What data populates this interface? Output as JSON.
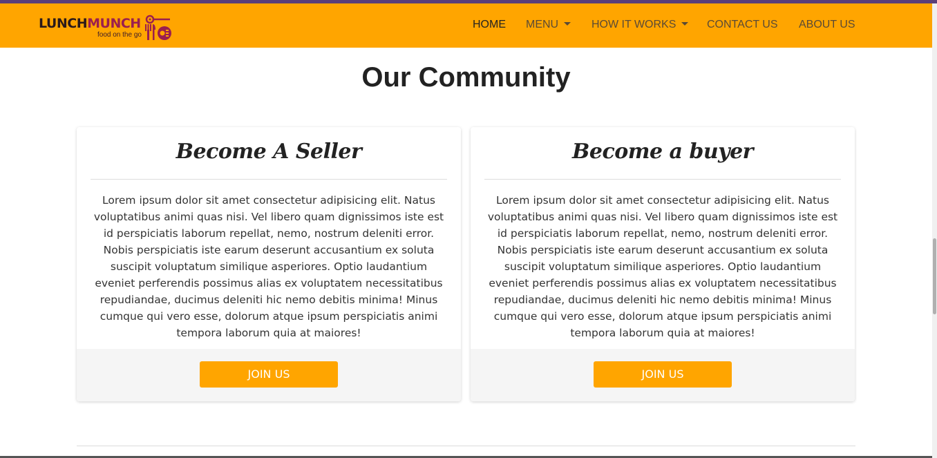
{
  "brand": {
    "name_part1": "LUNCH",
    "name_part2": "MUNCH",
    "tagline": "food on the go",
    "colors": {
      "navbar": "#ffa500",
      "accent": "#9b1f4e",
      "button": "#ffa500"
    }
  },
  "nav": {
    "items": [
      {
        "label": "HOME",
        "active": true,
        "dropdown": false
      },
      {
        "label": "MENU",
        "active": false,
        "dropdown": true
      },
      {
        "label": "HOW IT WORKS",
        "active": false,
        "dropdown": true
      },
      {
        "label": "CONTACT US",
        "active": false,
        "dropdown": false
      },
      {
        "label": "ABOUT US",
        "active": false,
        "dropdown": false
      }
    ]
  },
  "section": {
    "title": "Our Community"
  },
  "cards": [
    {
      "heading": "Become A Seller",
      "body": "Lorem ipsum dolor sit amet consectetur adipisicing elit. Natus voluptatibus animi quas nisi. Vel libero quam dignissimos iste est id perspiciatis laborum repellat, nemo, nostrum deleniti error. Nobis perspiciatis iste earum deserunt accusantium ex soluta suscipit voluptatum similique asperiores. Optio laudantium eveniet perferendis possimus alias ex voluptatem necessitatibus repudiandae, ducimus deleniti hic nemo debitis minima! Minus cumque qui vero esse, dolorum atque ipsum perspiciatis animi tempora laborum quia at maiores!",
      "button": "JOIN US"
    },
    {
      "heading": "Become a buyer",
      "body": "Lorem ipsum dolor sit amet consectetur adipisicing elit. Natus voluptatibus animi quas nisi. Vel libero quam dignissimos iste est id perspiciatis laborum repellat, nemo, nostrum deleniti error. Nobis perspiciatis iste earum deserunt accusantium ex soluta suscipit voluptatum similique asperiores. Optio laudantium eveniet perferendis possimus alias ex voluptatem necessitatibus repudiandae, ducimus deleniti hic nemo debitis minima! Minus cumque qui vero esse, dolorum atque ipsum perspiciatis animi tempora laborum quia at maiores!",
      "button": "JOIN US"
    }
  ]
}
